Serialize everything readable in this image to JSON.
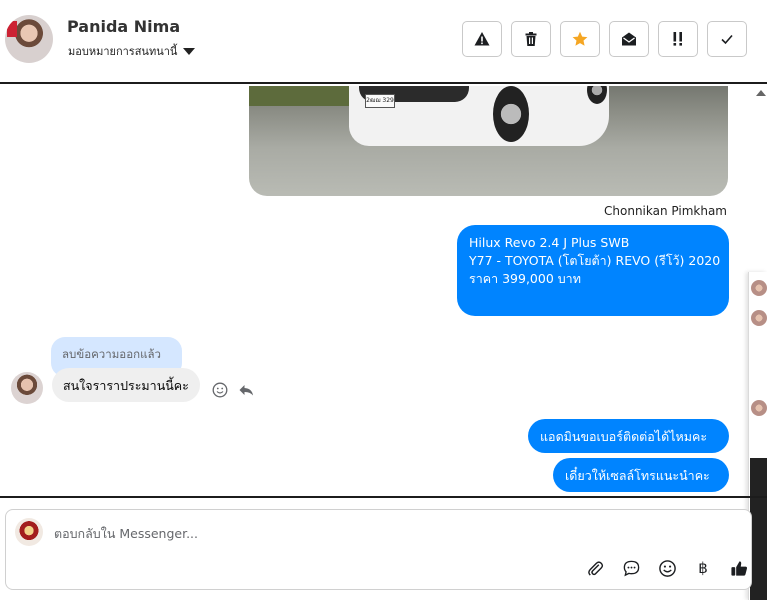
{
  "header": {
    "contact_name": "Panida Nima",
    "assign_label": "มอบหมายการสนทนานี้"
  },
  "actions": [
    {
      "name": "spam-button",
      "icon": "warning-icon"
    },
    {
      "name": "delete-button",
      "icon": "trash-icon"
    },
    {
      "name": "star-button",
      "icon": "star-icon"
    },
    {
      "name": "mark-unread-button",
      "icon": "envelope-open-icon"
    },
    {
      "name": "follow-up-button",
      "icon": "double-exclamation-icon"
    },
    {
      "name": "done-button",
      "icon": "check-icon"
    }
  ],
  "messages": {
    "photo_plate": "2ฒฌ 329",
    "sender_name": "Chonnikan Pimkham",
    "listing": {
      "line1": "Hilux Revo 2.4 J Plus SWB",
      "line2": "Y77 - TOYOTA (โตโยต้า) REVO (รีโว้) 2020",
      "price": "ราคา 399,000 บาท"
    },
    "deleted_notice": "ลบข้อความออกแล้ว",
    "incoming": "สนใจราราประมานนี้คะ",
    "outgoing1": "แอดมินขอเบอร์ติดต่อได้ไหมคะ",
    "outgoing2": "เดี๋ยวให้เซลล์โทรแนะนำคะ"
  },
  "composer": {
    "placeholder": "ตอบกลับใน Messenger...",
    "currency_symbol": "฿"
  },
  "colors": {
    "accent": "#0084ff",
    "star": "#f5a623",
    "deleted_bg": "#d5e7ff",
    "incoming_bg": "#efefef"
  }
}
